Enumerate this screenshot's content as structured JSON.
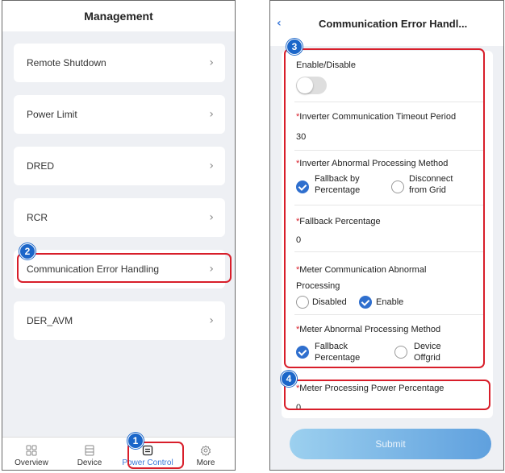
{
  "left": {
    "title": "Management",
    "menu": [
      {
        "label": "Remote Shutdown"
      },
      {
        "label": "Power Limit"
      },
      {
        "label": "DRED"
      },
      {
        "label": "RCR"
      },
      {
        "label": "Communication Error Handling"
      },
      {
        "label": "DER_AVM"
      }
    ],
    "tabs": [
      {
        "label": "Overview",
        "icon": "grid-icon"
      },
      {
        "label": "Device",
        "icon": "device-icon"
      },
      {
        "label": "Power Control",
        "icon": "power-control-icon",
        "active": true
      },
      {
        "label": "More",
        "icon": "gear-icon"
      }
    ]
  },
  "right": {
    "title": "Communication Error Handl...",
    "enable_label": "Enable/Disable",
    "timeout_label": "Inverter Communication Timeout Period",
    "timeout_value": "30",
    "inv_method_label": "Inverter Abnormal Processing Method",
    "inv_opt1_line1": "Fallback by",
    "inv_opt1_line2": "Percentage",
    "inv_opt2_line1": "Disconnect",
    "inv_opt2_line2": "from Grid",
    "fallback_label": "Fallback Percentage",
    "fallback_value": "0",
    "meter_comm_line1": "Meter Communication Abnormal",
    "meter_comm_line2": "Processing",
    "meter_opt_disabled": "Disabled",
    "meter_opt_enable": "Enable",
    "meter_method_label": "Meter Abnormal Processing Method",
    "meter_m_opt1_line1": "Fallback",
    "meter_m_opt1_line2": "Percentage",
    "meter_m_opt2_line1": "Device",
    "meter_m_opt2_line2": "Offgrid",
    "meter_power_label": "Meter Processing Power Percentage",
    "meter_power_value": "0",
    "required_mark": "*",
    "submit_label": "Submit"
  },
  "annotations": {
    "badge1": "1",
    "badge2": "2",
    "badge3": "3",
    "badge4": "4",
    "callout_color": "#d81e2a",
    "badge_color": "#1b66c9"
  },
  "colors": {
    "accent": "#2f6fce",
    "active_tab": "#3a78d8"
  }
}
